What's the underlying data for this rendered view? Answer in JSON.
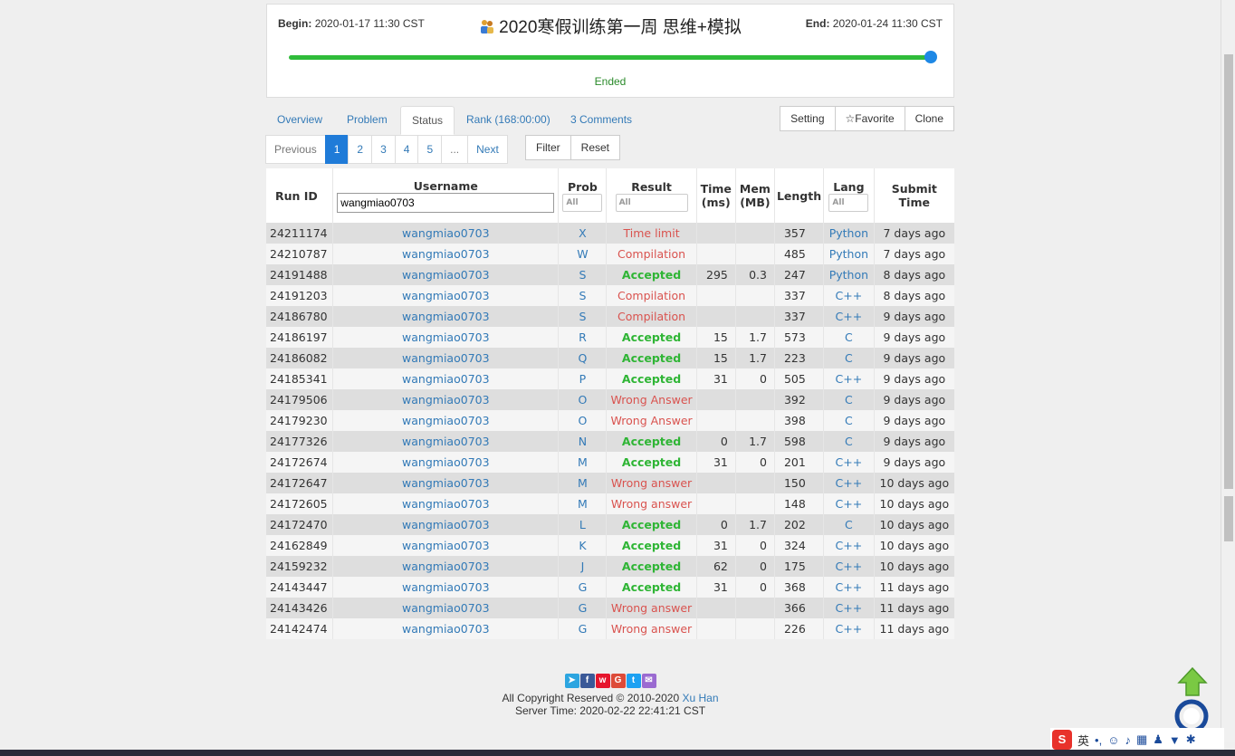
{
  "contest": {
    "begin_label": "Begin:",
    "begin_value": "2020-01-17 11:30 CST",
    "end_label": "End:",
    "end_value": "2020-01-24 11:30 CST",
    "title": "2020寒假训练第一周 思维+模拟",
    "progress": 1.0,
    "state": "Ended"
  },
  "tabs": [
    "Overview",
    "Problem",
    "Status",
    "Rank (168:00:00)",
    "3 Comments"
  ],
  "active_tab": "Status",
  "actions": [
    "Setting",
    "☆Favorite",
    "Clone"
  ],
  "pager": {
    "prev": "Previous",
    "pages": [
      "1",
      "2",
      "3",
      "4",
      "5",
      "..."
    ],
    "next": "Next",
    "current": "1"
  },
  "filter_label": "Filter",
  "reset_label": "Reset",
  "table": {
    "headers": {
      "run_id": "Run ID",
      "username": "Username",
      "prob": "Prob",
      "result": "Result",
      "time_1": "Time",
      "time_2": "(ms)",
      "mem_1": "Mem",
      "mem_2": "(MB)",
      "length": "Length",
      "lang": "Lang",
      "submit_1": "Submit",
      "submit_2": "Time"
    },
    "username_filter": "wangmiao0703",
    "select_all": "All",
    "rows": [
      {
        "id": "24211174",
        "user": "wangmiao0703",
        "prob": "X",
        "result": "Time limit",
        "ok": false,
        "time": "",
        "mem": "",
        "len": "357",
        "lang": "Python",
        "submit": "7 days ago"
      },
      {
        "id": "24210787",
        "user": "wangmiao0703",
        "prob": "W",
        "result": "Compilation",
        "ok": false,
        "time": "",
        "mem": "",
        "len": "485",
        "lang": "Python",
        "submit": "7 days ago"
      },
      {
        "id": "24191488",
        "user": "wangmiao0703",
        "prob": "S",
        "result": "Accepted",
        "ok": true,
        "time": "295",
        "mem": "0.3",
        "len": "247",
        "lang": "Python",
        "submit": "8 days ago"
      },
      {
        "id": "24191203",
        "user": "wangmiao0703",
        "prob": "S",
        "result": "Compilation",
        "ok": false,
        "time": "",
        "mem": "",
        "len": "337",
        "lang": "C++",
        "submit": "8 days ago"
      },
      {
        "id": "24186780",
        "user": "wangmiao0703",
        "prob": "S",
        "result": "Compilation",
        "ok": false,
        "time": "",
        "mem": "",
        "len": "337",
        "lang": "C++",
        "submit": "9 days ago"
      },
      {
        "id": "24186197",
        "user": "wangmiao0703",
        "prob": "R",
        "result": "Accepted",
        "ok": true,
        "time": "15",
        "mem": "1.7",
        "len": "573",
        "lang": "C",
        "submit": "9 days ago"
      },
      {
        "id": "24186082",
        "user": "wangmiao0703",
        "prob": "Q",
        "result": "Accepted",
        "ok": true,
        "time": "15",
        "mem": "1.7",
        "len": "223",
        "lang": "C",
        "submit": "9 days ago"
      },
      {
        "id": "24185341",
        "user": "wangmiao0703",
        "prob": "P",
        "result": "Accepted",
        "ok": true,
        "time": "31",
        "mem": "0",
        "len": "505",
        "lang": "C++",
        "submit": "9 days ago"
      },
      {
        "id": "24179506",
        "user": "wangmiao0703",
        "prob": "O",
        "result": "Wrong Answer",
        "ok": false,
        "time": "",
        "mem": "",
        "len": "392",
        "lang": "C",
        "submit": "9 days ago"
      },
      {
        "id": "24179230",
        "user": "wangmiao0703",
        "prob": "O",
        "result": "Wrong Answer",
        "ok": false,
        "time": "",
        "mem": "",
        "len": "398",
        "lang": "C",
        "submit": "9 days ago"
      },
      {
        "id": "24177326",
        "user": "wangmiao0703",
        "prob": "N",
        "result": "Accepted",
        "ok": true,
        "time": "0",
        "mem": "1.7",
        "len": "598",
        "lang": "C",
        "submit": "9 days ago"
      },
      {
        "id": "24172674",
        "user": "wangmiao0703",
        "prob": "M",
        "result": "Accepted",
        "ok": true,
        "time": "31",
        "mem": "0",
        "len": "201",
        "lang": "C++",
        "submit": "9 days ago"
      },
      {
        "id": "24172647",
        "user": "wangmiao0703",
        "prob": "M",
        "result": "Wrong answer",
        "ok": false,
        "time": "",
        "mem": "",
        "len": "150",
        "lang": "C++",
        "submit": "10 days ago"
      },
      {
        "id": "24172605",
        "user": "wangmiao0703",
        "prob": "M",
        "result": "Wrong answer",
        "ok": false,
        "time": "",
        "mem": "",
        "len": "148",
        "lang": "C++",
        "submit": "10 days ago"
      },
      {
        "id": "24172470",
        "user": "wangmiao0703",
        "prob": "L",
        "result": "Accepted",
        "ok": true,
        "time": "0",
        "mem": "1.7",
        "len": "202",
        "lang": "C",
        "submit": "10 days ago"
      },
      {
        "id": "24162849",
        "user": "wangmiao0703",
        "prob": "K",
        "result": "Accepted",
        "ok": true,
        "time": "31",
        "mem": "0",
        "len": "324",
        "lang": "C++",
        "submit": "10 days ago"
      },
      {
        "id": "24159232",
        "user": "wangmiao0703",
        "prob": "J",
        "result": "Accepted",
        "ok": true,
        "time": "62",
        "mem": "0",
        "len": "175",
        "lang": "C++",
        "submit": "10 days ago"
      },
      {
        "id": "24143447",
        "user": "wangmiao0703",
        "prob": "G",
        "result": "Accepted",
        "ok": true,
        "time": "31",
        "mem": "0",
        "len": "368",
        "lang": "C++",
        "submit": "11 days ago"
      },
      {
        "id": "24143426",
        "user": "wangmiao0703",
        "prob": "G",
        "result": "Wrong answer",
        "ok": false,
        "time": "",
        "mem": "",
        "len": "366",
        "lang": "C++",
        "submit": "11 days ago"
      },
      {
        "id": "24142474",
        "user": "wangmiao0703",
        "prob": "G",
        "result": "Wrong answer",
        "ok": false,
        "time": "",
        "mem": "",
        "len": "226",
        "lang": "C++",
        "submit": "11 days ago"
      }
    ]
  },
  "footer": {
    "copyright": "All Copyright Reserved © 2010-2020",
    "author": "Xu Han",
    "server_time": "Server Time: 2020-02-22 22:41:21 CST",
    "social_icons": [
      "telegram-icon",
      "facebook-icon",
      "weibo-icon",
      "google-icon",
      "twitter-icon",
      "email-icon"
    ]
  },
  "ime": {
    "lang": "英"
  },
  "colors": {
    "accent": "#337ab7",
    "accepted": "#2fb535",
    "error": "#d9534f",
    "progress": "#2fbc3a",
    "current_page": "#1f7bd8"
  }
}
